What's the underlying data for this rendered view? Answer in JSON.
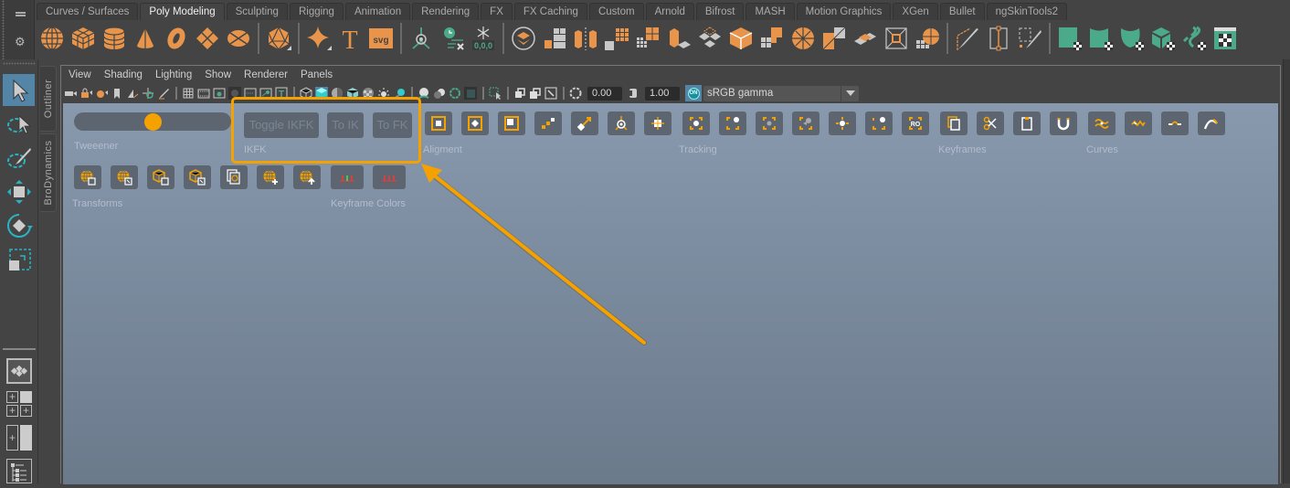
{
  "shelf": {
    "tabs": [
      {
        "label": "Curves / Surfaces",
        "active": false
      },
      {
        "label": "Poly Modeling",
        "active": true
      },
      {
        "label": "Sculpting",
        "active": false
      },
      {
        "label": "Rigging",
        "active": false
      },
      {
        "label": "Animation",
        "active": false
      },
      {
        "label": "Rendering",
        "active": false
      },
      {
        "label": "FX",
        "active": false
      },
      {
        "label": "FX Caching",
        "active": false
      },
      {
        "label": "Custom",
        "active": false
      },
      {
        "label": "Arnold",
        "active": false
      },
      {
        "label": "Bifrost",
        "active": false
      },
      {
        "label": "MASH",
        "active": false
      },
      {
        "label": "Motion Graphics",
        "active": false
      },
      {
        "label": "XGen",
        "active": false
      },
      {
        "label": "Bullet",
        "active": false
      },
      {
        "label": "ngSkinTools2",
        "active": false
      }
    ],
    "icons": [
      "poly-sphere-icon",
      "poly-cube-icon",
      "poly-cylinder-icon",
      "poly-cone-icon",
      "poly-torus-icon",
      "poly-plane-icon",
      "poly-disc-icon",
      "sep",
      "platonic-solid-icon",
      "sep",
      "super-shape-icon",
      "type-text-icon",
      "svg-icon",
      "sep",
      "sweep-mesh-icon",
      "history-delete-icon",
      "freeze-transform-icon",
      "sep",
      "combine-icon",
      "separate-icon",
      "mirror-icon",
      "smooth-icon",
      "bridge-icon",
      "extrude-icon",
      "bevel-icon",
      "split-icon",
      "edge-loop-icon",
      "insert-edge-icon",
      "target-weld-icon",
      "circularize-icon",
      "fill-hole-icon",
      "collapse-icon",
      "sep",
      "multi-cut-icon",
      "edge-tool-icon",
      "draw-tool-icon",
      "sep",
      "uv-planar-icon",
      "uv-cylindrical-icon",
      "uv-spherical-icon",
      "uv-automatic-icon",
      "uv-unfold-icon",
      "uv-editor-icon"
    ],
    "accent_orange": "#e8944a",
    "accent_teal": "#4aaa8a"
  },
  "toolbox": {
    "tools": [
      "select-tool-icon",
      "lasso-select-icon",
      "paint-select-icon",
      "move-tool-icon",
      "rotate-tool-icon",
      "scale-tool-icon"
    ],
    "layouts": [
      "single-view-layout-icon",
      "four-view-layout-icon",
      "two-view-layout-icon",
      "outliner-layout-icon"
    ]
  },
  "side_tabs": [
    "Outliner",
    "BroDynamics"
  ],
  "panel": {
    "menu": [
      "View",
      "Shading",
      "Lighting",
      "Show",
      "Renderer",
      "Panels"
    ],
    "exposure": "0.00",
    "gamma": "1.00",
    "color_management": "ON",
    "color_space": "sRGB gamma"
  },
  "viewport_shelf": {
    "tweener_label": "Tweeener",
    "tweener_value": 0.5,
    "ikfk": {
      "section_label": "IKFK",
      "buttons": [
        "Toggle IKFK",
        "To IK",
        "To FK"
      ]
    },
    "sections": {
      "alignment": "Aligment",
      "tracking": "Tracking",
      "keyframes": "Keyframes",
      "curves": "Curves",
      "transforms": "Transforms",
      "keyframe_colors": "Keyframe Colors"
    },
    "highlight_color": "#f5a200"
  }
}
